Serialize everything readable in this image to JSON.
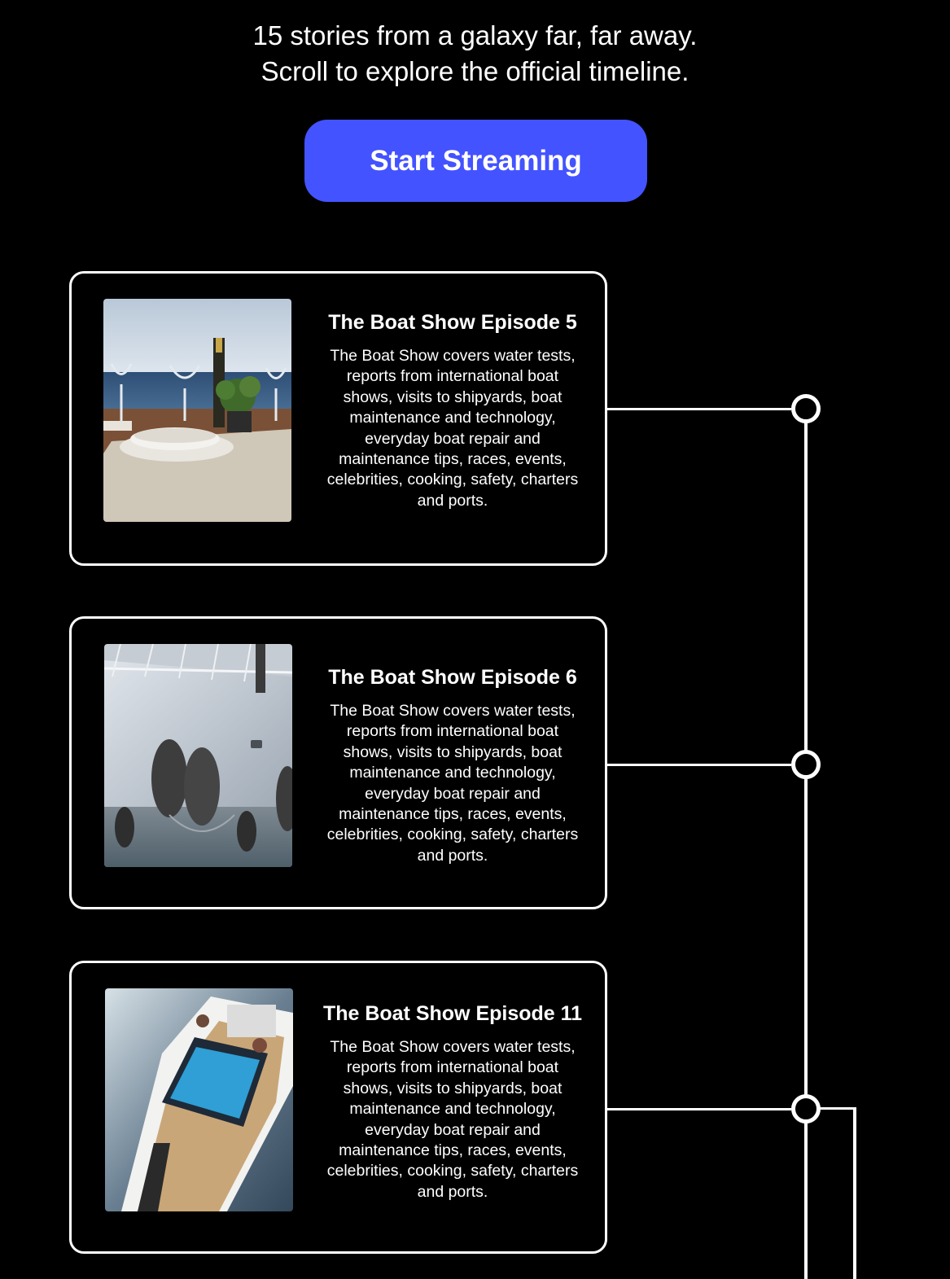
{
  "intro": {
    "line1": "15 stories from a galaxy far, far away.",
    "line2": "Scroll to explore the official timeline."
  },
  "cta": {
    "label": "Start Streaming",
    "color": "#4353ff"
  },
  "episodes": [
    {
      "title": "The Boat Show Episode 5",
      "description": "The Boat Show covers water tests, reports from international boat shows, visits to shipyards, boat maintenance and technology, everyday boat repair and maintenance tips, races, events, celebrities, cooking, safety, charters and ports.",
      "image": "yacht-deck-dining-table-photo"
    },
    {
      "title": "The Boat Show Episode 6",
      "description": "The Boat Show covers water tests, reports from international boat shows, visits to shipyards, boat maintenance and technology, everyday boat repair and maintenance tips, races, events, celebrities, cooking, safety, charters and ports.",
      "image": "yacht-hull-with-fenders-photo"
    },
    {
      "title": "The Boat Show Episode 11",
      "description": "The Boat Show covers water tests, reports from international boat shows, visits to shipyards, boat maintenance and technology, everyday boat repair and maintenance tips, races, events, celebrities, cooking, safety, charters and ports.",
      "image": "speedboat-aerial-view-photo"
    }
  ]
}
